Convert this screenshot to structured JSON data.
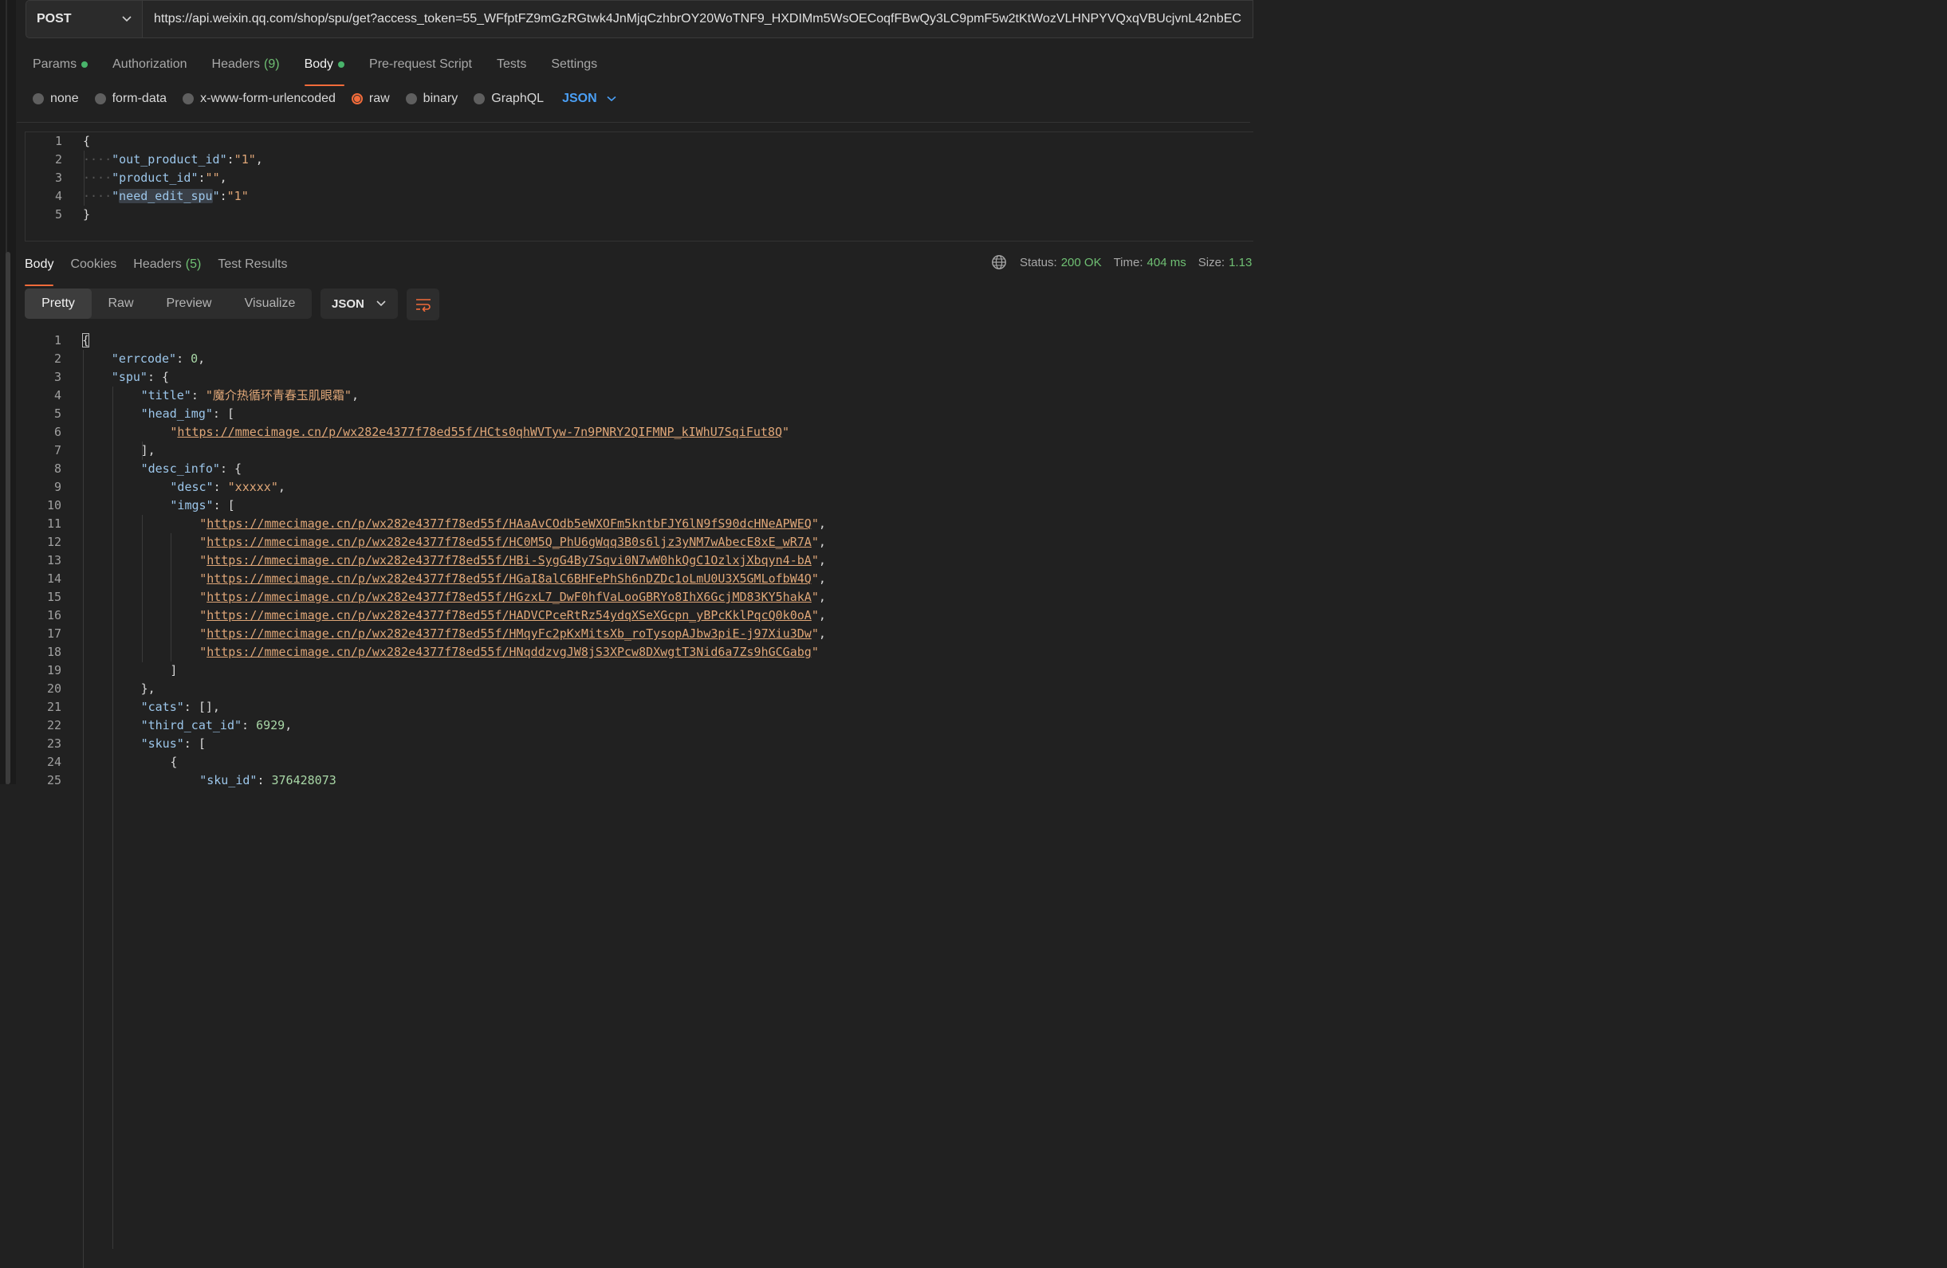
{
  "request": {
    "method": "POST",
    "url": "https://api.weixin.qq.com/shop/spu/get?access_token=55_WFfptFZ9mGzRGtwk4JnMjqCzhbrOY20WoTNF9_HXDIMm5WsOECoqfFBwQy3LC9pmF5w2tKtWozVLHNPYVQxqVBUcjvnL42nbEC"
  },
  "request_tabs": [
    {
      "label": "Params",
      "dot": true
    },
    {
      "label": "Authorization"
    },
    {
      "label": "Headers",
      "count": "(9)"
    },
    {
      "label": "Body",
      "dot": true,
      "active": true
    },
    {
      "label": "Pre-request Script"
    },
    {
      "label": "Tests"
    },
    {
      "label": "Settings"
    }
  ],
  "body_types": [
    "none",
    "form-data",
    "x-www-form-urlencoded",
    "raw",
    "binary",
    "GraphQL"
  ],
  "body_type_selected": "raw",
  "body_language": "JSON",
  "request_body_lines": [
    {
      "n": "1",
      "text": "{"
    },
    {
      "n": "2",
      "key": "out_product_id",
      "value": "1",
      "trail": ","
    },
    {
      "n": "3",
      "key": "product_id",
      "value": "",
      "trail": ","
    },
    {
      "n": "4",
      "key": "need_edit_spu",
      "value": "1",
      "trail": ""
    },
    {
      "n": "5",
      "text": "}"
    }
  ],
  "response_tabs": [
    {
      "label": "Body",
      "active": true
    },
    {
      "label": "Cookies"
    },
    {
      "label": "Headers",
      "count": "(5)"
    },
    {
      "label": "Test Results"
    }
  ],
  "status": {
    "status_label": "Status:",
    "status_value": "200 OK",
    "time_label": "Time:",
    "time_value": "404 ms",
    "size_label": "Size:",
    "size_value": "1.13"
  },
  "view_modes": [
    "Pretty",
    "Raw",
    "Preview",
    "Visualize"
  ],
  "view_mode_selected": "Pretty",
  "response_format": "JSON",
  "response_lines": [
    {
      "n": "1",
      "indent": 0,
      "parts": [
        [
          "p",
          "{"
        ]
      ]
    },
    {
      "n": "2",
      "indent": 1,
      "parts": [
        [
          "k",
          "\"errcode\""
        ],
        [
          "p",
          ": "
        ],
        [
          "n",
          "0"
        ],
        [
          "p",
          ","
        ]
      ]
    },
    {
      "n": "3",
      "indent": 1,
      "parts": [
        [
          "k",
          "\"spu\""
        ],
        [
          "p",
          ": {"
        ]
      ]
    },
    {
      "n": "4",
      "indent": 2,
      "parts": [
        [
          "k",
          "\"title\""
        ],
        [
          "p",
          ": "
        ],
        [
          "s",
          "\"魔介热循环青春玉肌眼霜\""
        ],
        [
          "p",
          ","
        ]
      ]
    },
    {
      "n": "5",
      "indent": 2,
      "parts": [
        [
          "k",
          "\"head_img\""
        ],
        [
          "p",
          ": ["
        ]
      ]
    },
    {
      "n": "6",
      "indent": 3,
      "parts": [
        [
          "s",
          "\""
        ],
        [
          "u",
          "https://mmecimage.cn/p/wx282e4377f78ed55f/HCts0qhWVTyw-7n9PNRY2QIFMNP_kIWhU7SqiFut8Q"
        ],
        [
          "s",
          "\""
        ]
      ]
    },
    {
      "n": "7",
      "indent": 2,
      "parts": [
        [
          "p",
          "],"
        ]
      ]
    },
    {
      "n": "8",
      "indent": 2,
      "parts": [
        [
          "k",
          "\"desc_info\""
        ],
        [
          "p",
          ": {"
        ]
      ]
    },
    {
      "n": "9",
      "indent": 3,
      "parts": [
        [
          "k",
          "\"desc\""
        ],
        [
          "p",
          ": "
        ],
        [
          "s",
          "\"xxxxx\""
        ],
        [
          "p",
          ","
        ]
      ]
    },
    {
      "n": "10",
      "indent": 3,
      "parts": [
        [
          "k",
          "\"imgs\""
        ],
        [
          "p",
          ": ["
        ]
      ]
    },
    {
      "n": "11",
      "indent": 4,
      "parts": [
        [
          "s",
          "\""
        ],
        [
          "u",
          "https://mmecimage.cn/p/wx282e4377f78ed55f/HAaAvCOdb5eWXOFm5kntbFJY6lN9fS90dcHNeAPWEQ"
        ],
        [
          "s",
          "\""
        ],
        [
          "p",
          ","
        ]
      ]
    },
    {
      "n": "12",
      "indent": 4,
      "parts": [
        [
          "s",
          "\""
        ],
        [
          "u",
          "https://mmecimage.cn/p/wx282e4377f78ed55f/HC0M5Q_PhU6gWqq3B0s6ljz3yNM7wAbecE8xE_wR7A"
        ],
        [
          "s",
          "\""
        ],
        [
          "p",
          ","
        ]
      ]
    },
    {
      "n": "13",
      "indent": 4,
      "parts": [
        [
          "s",
          "\""
        ],
        [
          "u",
          "https://mmecimage.cn/p/wx282e4377f78ed55f/HBi-SygG4By7Sqvi0N7wW0hkQgC1OzlxjXbqyn4-bA"
        ],
        [
          "s",
          "\""
        ],
        [
          "p",
          ","
        ]
      ]
    },
    {
      "n": "14",
      "indent": 4,
      "parts": [
        [
          "s",
          "\""
        ],
        [
          "u",
          "https://mmecimage.cn/p/wx282e4377f78ed55f/HGaI8alC6BHFePhSh6nDZDc1oLmU0U3X5GMLofbW4Q"
        ],
        [
          "s",
          "\""
        ],
        [
          "p",
          ","
        ]
      ]
    },
    {
      "n": "15",
      "indent": 4,
      "parts": [
        [
          "s",
          "\""
        ],
        [
          "u",
          "https://mmecimage.cn/p/wx282e4377f78ed55f/HGzxL7_DwF0hfVaLooGBRYo8IhX6GcjMD83KY5hakA"
        ],
        [
          "s",
          "\""
        ],
        [
          "p",
          ","
        ]
      ]
    },
    {
      "n": "16",
      "indent": 4,
      "parts": [
        [
          "s",
          "\""
        ],
        [
          "u",
          "https://mmecimage.cn/p/wx282e4377f78ed55f/HADVCPceRtRz54ydqXSeXGcpn_yBPcKklPqcQ0k0oA"
        ],
        [
          "s",
          "\""
        ],
        [
          "p",
          ","
        ]
      ]
    },
    {
      "n": "17",
      "indent": 4,
      "parts": [
        [
          "s",
          "\""
        ],
        [
          "u",
          "https://mmecimage.cn/p/wx282e4377f78ed55f/HMqyFc2pKxMitsXb_roTysopAJbw3piE-j97Xiu3Dw"
        ],
        [
          "s",
          "\""
        ],
        [
          "p",
          ","
        ]
      ]
    },
    {
      "n": "18",
      "indent": 4,
      "parts": [
        [
          "s",
          "\""
        ],
        [
          "u",
          "https://mmecimage.cn/p/wx282e4377f78ed55f/HNqddzvgJW8jS3XPcw8DXwgtT3Nid6a7Zs9hGCGabg"
        ],
        [
          "s",
          "\""
        ]
      ]
    },
    {
      "n": "19",
      "indent": 3,
      "parts": [
        [
          "p",
          "]"
        ]
      ]
    },
    {
      "n": "20",
      "indent": 2,
      "parts": [
        [
          "p",
          "},"
        ]
      ]
    },
    {
      "n": "21",
      "indent": 2,
      "parts": [
        [
          "k",
          "\"cats\""
        ],
        [
          "p",
          ": [],"
        ]
      ]
    },
    {
      "n": "22",
      "indent": 2,
      "parts": [
        [
          "k",
          "\"third_cat_id\""
        ],
        [
          "p",
          ": "
        ],
        [
          "n",
          "6929"
        ],
        [
          "p",
          ","
        ]
      ]
    },
    {
      "n": "23",
      "indent": 2,
      "parts": [
        [
          "k",
          "\"skus\""
        ],
        [
          "p",
          ": ["
        ]
      ]
    },
    {
      "n": "24",
      "indent": 3,
      "parts": [
        [
          "p",
          "{"
        ]
      ]
    },
    {
      "n": "25",
      "indent": 4,
      "parts": [
        [
          "k",
          "\"sku_id\""
        ],
        [
          "p",
          ": "
        ],
        [
          "n",
          "376428073"
        ]
      ]
    }
  ],
  "colors": {
    "accent": "#f26b3a",
    "ok": "#6fbf73",
    "link_blue": "#4a9ff5"
  },
  "icons": {
    "chevron": "chevron-down-icon",
    "globe": "globe-icon",
    "wrap": "word-wrap-icon"
  }
}
